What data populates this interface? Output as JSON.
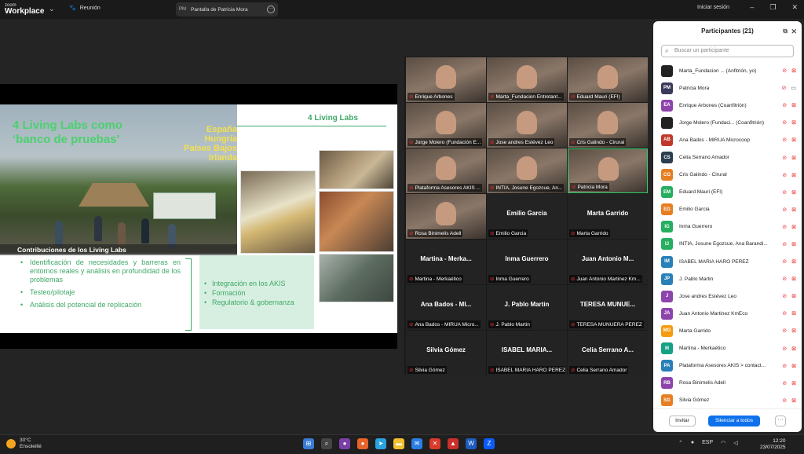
{
  "app": {
    "brand_top": "zoom",
    "brand_bottom": "Workplace",
    "meeting_label": "Reunión",
    "share_initials": "PM",
    "share_title": "Pantalla de Patricia Mora",
    "signin": "Iniciar sesión"
  },
  "slide": {
    "title_line1": "4 Living Labs como",
    "title_line2": "‘banco de pruebas’",
    "countries": [
      "España",
      "Hungría",
      "Países Bajos",
      "Irlanda"
    ],
    "ll_title": "4 Living Labs",
    "contrib_title": "Contribuciones de los Living Labs",
    "bullets": [
      "Identificación de necesidades y barreras en entornos reales y análisis en profundidad de los problemas",
      "Testeo/pilotaje",
      "Análisis del potencial de replicación"
    ],
    "box_items": [
      "Integración en los AKIS",
      "Formación",
      "Regulatorio & gobernanza"
    ]
  },
  "tiles": [
    {
      "label": "Enrique Arbones",
      "big": ""
    },
    {
      "label": "Marta_Fundacion Entretant...",
      "big": ""
    },
    {
      "label": "Eduard Mauri (EFI)",
      "big": ""
    },
    {
      "label": "Jorge Molero (Fundación E...",
      "big": ""
    },
    {
      "label": "Jose andres Estévez Leo",
      "big": ""
    },
    {
      "label": "Cris Galindo - Cirural",
      "big": ""
    },
    {
      "label": "Plataforma Asesores AKIS ...",
      "big": ""
    },
    {
      "label": "INTIA, Josune Egozcue, An...",
      "big": ""
    },
    {
      "label": "Patricia Mora",
      "big": ""
    },
    {
      "label": "Rosa Binimelis Adell",
      "big": ""
    },
    {
      "label": "Emilio Garcia",
      "big": "Emilio Garcia"
    },
    {
      "label": "Marta Garrido",
      "big": "Marta Garrido"
    },
    {
      "label": "Martina - Merkaético",
      "big": "Martina - Merka..."
    },
    {
      "label": "Inma Guerrero",
      "big": "Inma Guerrero"
    },
    {
      "label": "Juan Antonio Martinez Km...",
      "big": "Juan Antonio M..."
    },
    {
      "label": "Ana Bados - MIRUA Micro...",
      "big": "Ana Bados - MI..."
    },
    {
      "label": "J. Pablo Martin",
      "big": "J. Pablo Martin"
    },
    {
      "label": "TERESA MUNUERA PEREZ",
      "big": "TERESA MUNUE..."
    },
    {
      "label": "Silvia Gómez",
      "big": "Silvia Gómez"
    },
    {
      "label": "ISABEL MARIA HARO PEREZ",
      "big": "ISABEL MARIA..."
    },
    {
      "label": "Celia Serrano Amador",
      "big": "Celia Serrano A..."
    }
  ],
  "panel": {
    "title": "Participantes (21)",
    "search_placeholder": "Buscar un participante",
    "invite": "Invitar",
    "mute_all": "Silenciar a todos",
    "more": "···",
    "participants": [
      {
        "initials": "",
        "name": "Marta_Fundacion ... (Anfitrión, yo)",
        "color": "#222222",
        "cam_on": false
      },
      {
        "initials": "PM",
        "name": "Patricia Mora",
        "color": "#3a3a5a",
        "cam_on": true
      },
      {
        "initials": "EA",
        "name": "Enrique Arbones (Coanfitrión)",
        "color": "#8e44ad",
        "cam_on": false
      },
      {
        "initials": "",
        "name": "Jorge Molero (Fundaci... (Coanfitrión)",
        "color": "#222222",
        "cam_on": false
      },
      {
        "initials": "AB",
        "name": "Ana Bados - MIRUA Microcoop",
        "color": "#c0392b",
        "cam_on": false
      },
      {
        "initials": "CS",
        "name": "Celia Serrano Amador",
        "color": "#2c3e50",
        "cam_on": false
      },
      {
        "initials": "CG",
        "name": "Cris Galindo - Cirural",
        "color": "#e67e22",
        "cam_on": false
      },
      {
        "initials": "EM",
        "name": "Eduard Mauri (EFI)",
        "color": "#27ae60",
        "cam_on": false
      },
      {
        "initials": "EG",
        "name": "Emilio Garcia",
        "color": "#e67e22",
        "cam_on": false
      },
      {
        "initials": "IG",
        "name": "Inma Guerrero",
        "color": "#27ae60",
        "cam_on": false
      },
      {
        "initials": "IJ",
        "name": "INTIA, Josune Egozcue, Ana Barandi...",
        "color": "#27ae60",
        "cam_on": false
      },
      {
        "initials": "IM",
        "name": "ISABEL MARIA HARO PEREZ",
        "color": "#2980b9",
        "cam_on": false
      },
      {
        "initials": "JP",
        "name": "J. Pablo Martin",
        "color": "#2980b9",
        "cam_on": false
      },
      {
        "initials": "J",
        "name": "Jose andres Estévez Leo",
        "color": "#8e44ad",
        "cam_on": false
      },
      {
        "initials": "JA",
        "name": "Juan Antonio Martinez KmEco",
        "color": "#8e44ad",
        "cam_on": false
      },
      {
        "initials": "MG",
        "name": "Marta Garrido",
        "color": "#f39c12",
        "cam_on": false
      },
      {
        "initials": "M",
        "name": "Martina - Merkaético",
        "color": "#16a085",
        "cam_on": false
      },
      {
        "initials": "PA",
        "name": "Plataforma Asesores AKIS > contact...",
        "color": "#2980b9",
        "cam_on": false
      },
      {
        "initials": "RB",
        "name": "Rosa Binimelis Adell",
        "color": "#8e44ad",
        "cam_on": false
      },
      {
        "initials": "SG",
        "name": "Silvia Gómez",
        "color": "#e67e22",
        "cam_on": false
      }
    ]
  },
  "taskbar": {
    "temp": "30°C",
    "condition": "Ensoleillé",
    "lang": "ESP",
    "time": "12:20",
    "date": "23/07/2025"
  }
}
